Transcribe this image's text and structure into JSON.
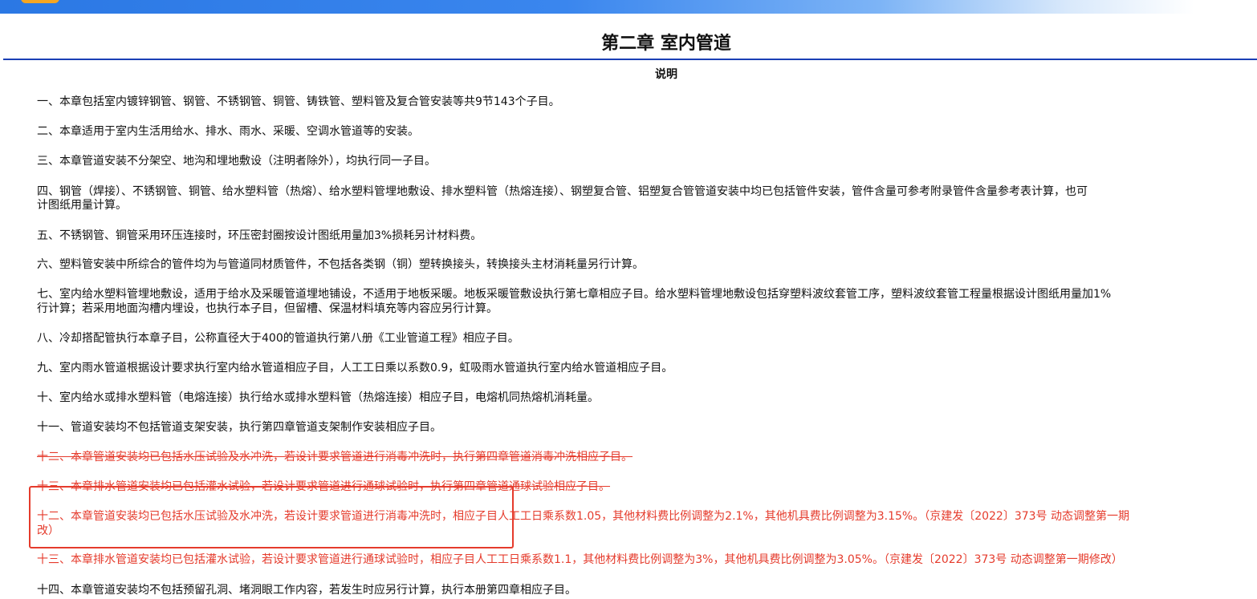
{
  "title": "第二章 室内管道",
  "subtitle": "说明",
  "items": [
    {
      "text": "一、本章包括室内镀锌钢管、钢管、不锈钢管、铜管、铸铁管、塑料管及复合管安装等共9节143个子目。"
    },
    {
      "text": "二、本章适用于室内生活用给水、排水、雨水、采暖、空调水管道等的安装。"
    },
    {
      "text": "三、本章管道安装不分架空、地沟和埋地敷设（注明者除外），均执行同一子目。"
    },
    {
      "text": "四、钢管（焊接）、不锈钢管、铜管、给水塑料管（热熔）、给水塑料管埋地敷设、排水塑料管（热熔连接）、钢塑复合管、铝塑复合管管道安装中均已包括管件安装，管件含量可参考附录管件含量参考表计算，也可",
      "text2": "计图纸用量计算。"
    },
    {
      "text": "五、不锈钢管、铜管采用环压连接时，环压密封圈按设计图纸用量加3%损耗另计材料费。"
    },
    {
      "text": "六、塑料管安装中所综合的管件均为与管道同材质管件，不包括各类钢（铜）塑转换接头，转换接头主材消耗量另行计算。"
    },
    {
      "text": "七、室内给水塑料管埋地敷设，适用于给水及采暖管道埋地铺设，不适用于地板采暖。地板采暖管敷设执行第七章相应子目。给水塑料管埋地敷设包括穿塑料波纹套管工序，塑料波纹套管工程量根据设计图纸用量加1%",
      "text2": "行计算；若采用地面沟槽内埋设，也执行本子目，但留槽、保温材料填充等内容应另行计算。"
    },
    {
      "text": "八、冷却搭配管执行本章子目，公称直径大于400的管道执行第八册《工业管道工程》相应子目。"
    },
    {
      "text": "九、室内雨水管道根据设计要求执行室内给水管道相应子目，人工工日乘以系数0.9，虹吸雨水管道执行室内给水管道相应子目。"
    },
    {
      "text": "十、室内给水或排水塑料管（电熔连接）执行给水或排水塑料管（热熔连接）相应子目，电熔机同热熔机消耗量。"
    },
    {
      "text": "十一、管道安装均不包括管道支架安装，执行第四章管道支架制作安装相应子目。"
    },
    {
      "text": "十二、本章管道安装均已包括水压试验及水冲洗，若设计要求管道进行消毒冲洗时，执行第四章管道消毒冲洗相应子目。"
    },
    {
      "text": "十三、本章排水管道安装均已包括灌水试验，若设计要求管道进行通球试验时，执行第四章管道通球试验相应子目。"
    },
    {
      "text": "十二、本章管道安装均已包括水压试验及水冲洗，若设计要求管道进行消毒冲洗时，相应子目人工工日乘系数1.05，其他材料费比例调整为2.1%，其他机具费比例调整为3.15%。（京建发〔2022〕373号 动态调整第一期",
      "text2": "改）"
    },
    {
      "text": "十三、本章排水管道安装均已包括灌水试验，若设计要求管道进行通球试验时，相应子目人工工日乘系数1.1，其他材料费比例调整为3%，其他机具费比例调整为3.05%。（京建发〔2022〕373号 动态调整第一期修改）"
    },
    {
      "text": "十四、本章管道安装均不包括预留孔洞、堵洞眼工作内容，若发生时应另行计算，执行本册第四章相应子目。"
    }
  ],
  "colors": {
    "accent_red": "#e53b2c",
    "rule_blue": "#1a3fb5",
    "topbar_blue": "#2b78e4"
  }
}
